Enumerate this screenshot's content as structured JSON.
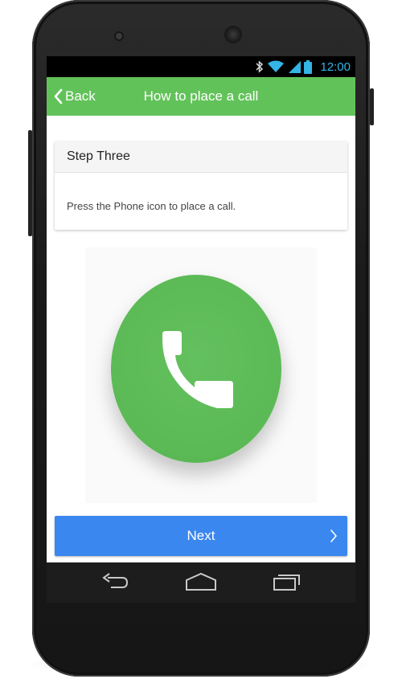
{
  "status_bar": {
    "time": "12:00",
    "icons": [
      "bluetooth-icon",
      "wifi-icon",
      "signal-icon",
      "battery-icon"
    ],
    "accent_color": "#33b5e5"
  },
  "app_bar": {
    "back_label": "Back",
    "title": "How to place a call",
    "color": "#62c25a"
  },
  "step_card": {
    "title": "Step Three",
    "body": "Press the Phone icon to place a call."
  },
  "illustration": {
    "icon": "phone-icon",
    "circle_color": "#5bba55"
  },
  "next_button": {
    "label": "Next",
    "icon": "chevron-right-icon",
    "color": "#3a87ef"
  },
  "nav_bar": {
    "items": [
      "back-nav-icon",
      "home-icon",
      "recent-apps-icon"
    ]
  }
}
